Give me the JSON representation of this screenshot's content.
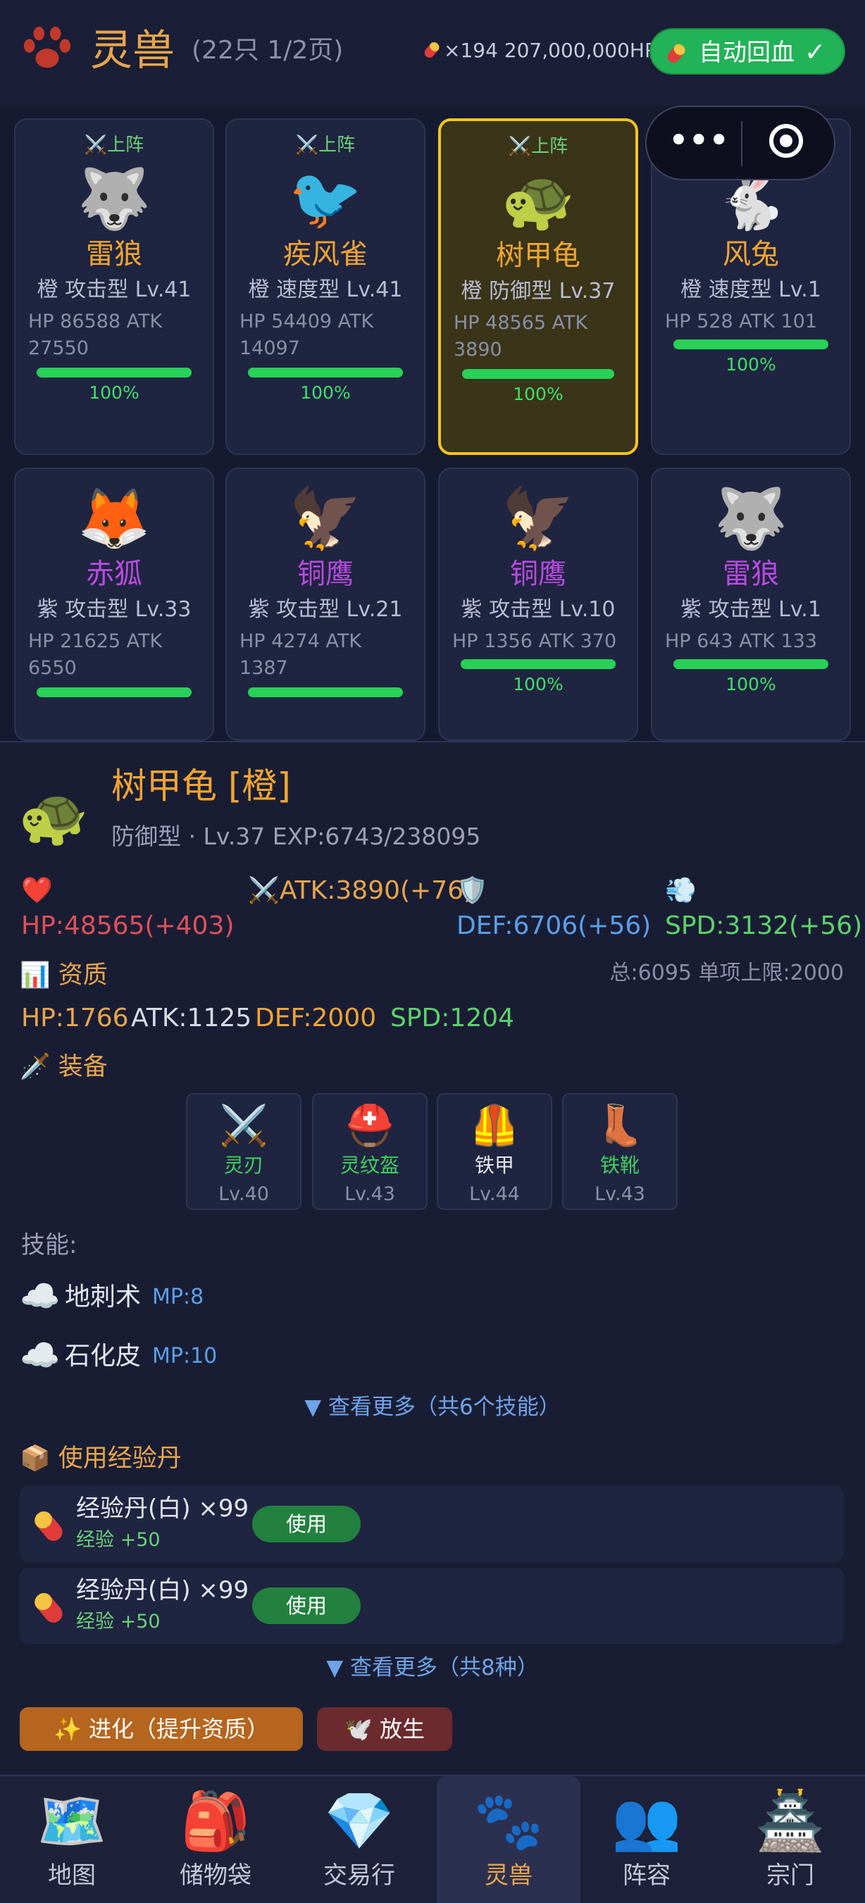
{
  "header": {
    "title": "灵兽",
    "subtitle": "(22只 1/2页)",
    "stock_text": "×194 207,000,000HP",
    "auto_heal_label": "自动回血",
    "auto_heal_check": "✓",
    "paw_icon": "paw-icon",
    "pill_icon": "pill-icon"
  },
  "pets": [
    {
      "tag": "⚔️上阵",
      "emoji": "🐺",
      "name": "雷狼",
      "meta": "橙 攻击型 Lv.41",
      "stats": "HP 86588  ATK 27550",
      "hp_pct_text": "100%",
      "hp_fraction": 1.0,
      "name_color": "#f0a531",
      "selected": false
    },
    {
      "tag": "⚔️上阵",
      "emoji": "🐦",
      "name": "疾风雀",
      "meta": "橙 速度型 Lv.41",
      "stats": "HP 54409  ATK 14097",
      "hp_pct_text": "100%",
      "hp_fraction": 1.0,
      "name_color": "#f0a531",
      "selected": false
    },
    {
      "tag": "⚔️上阵",
      "emoji": "🐢",
      "name": "树甲龟",
      "meta": "橙 防御型 Lv.37",
      "stats": "HP 48565  ATK 3890",
      "hp_pct_text": "100%",
      "hp_fraction": 1.0,
      "name_color": "#f0a531",
      "selected": true
    },
    {
      "tag": "",
      "emoji": "🐇",
      "name": "风兔",
      "meta": "橙 速度型 Lv.1",
      "stats": "HP 528  ATK 101",
      "hp_pct_text": "100%",
      "hp_fraction": 1.0,
      "name_color": "#f0a531",
      "selected": false
    },
    {
      "tag": "",
      "emoji": "🦊",
      "name": "赤狐",
      "meta": "紫 攻击型 Lv.33",
      "stats": "HP 21625  ATK 6550",
      "hp_pct_text": "",
      "hp_fraction": 1.0,
      "name_color": "#b84be0",
      "selected": false
    },
    {
      "tag": "",
      "emoji": "🦅",
      "name": "铜鹰",
      "meta": "紫 攻击型 Lv.21",
      "stats": "HP 4274  ATK 1387",
      "hp_pct_text": "",
      "hp_fraction": 1.0,
      "name_color": "#b84be0",
      "selected": false
    },
    {
      "tag": "",
      "emoji": "🦅",
      "name": "铜鹰",
      "meta": "紫 攻击型 Lv.10",
      "stats": "HP 1356  ATK 370",
      "hp_pct_text": "100%",
      "hp_fraction": 1.0,
      "name_color": "#b84be0",
      "selected": false
    },
    {
      "tag": "",
      "emoji": "🐺",
      "name": "雷狼",
      "meta": "紫 攻击型 Lv.1",
      "stats": "HP 643  ATK 133",
      "hp_pct_text": "100%",
      "hp_fraction": 1.0,
      "name_color": "#b84be0",
      "selected": false
    }
  ],
  "detail": {
    "emoji": "🐢",
    "name": "树甲龟 [橙]",
    "subtitle": "防御型 · Lv.37 EXP:6743/238095",
    "hp": "❤️HP:48565(+403)",
    "atk": "⚔️ATK:3890(+76)",
    "def": "🛡️DEF:6706(+56)",
    "spd": "💨SPD:3132(+56)",
    "aptitude_title": "📊 资质",
    "aptitude_total": "总:6095 单项上限:2000",
    "apt_hp": "HP:1766",
    "apt_atk": "ATK:1125",
    "apt_def": "DEF:2000",
    "apt_spd": "SPD:1204",
    "equip_title": "🗡️ 装备",
    "equipment": [
      {
        "icon": "⚔️",
        "name": "灵刃",
        "level": "Lv.40",
        "color": "#3ecf5e"
      },
      {
        "icon": "⛑️",
        "name": "灵纹盔",
        "level": "Lv.43",
        "color": "#3ecf5e"
      },
      {
        "icon": "🦺",
        "name": "铁甲",
        "level": "Lv.44",
        "color": "#e4e7f2"
      },
      {
        "icon": "👢",
        "name": "铁靴",
        "level": "Lv.43",
        "color": "#3ecf5e"
      }
    ],
    "skills_title": "技能:",
    "skills": [
      {
        "icon": "☁️",
        "name": "地刺术",
        "mp": "MP:8"
      },
      {
        "icon": "☁️",
        "name": "石化皮",
        "mp": "MP:10"
      }
    ],
    "more_skills": "▼ 查看更多（共6个技能）",
    "exp_title": "📦 使用经验丹",
    "items": [
      {
        "name": "经验丹(白) ×99",
        "effect": "经验 +50",
        "use": "使用"
      },
      {
        "name": "经验丹(白) ×99",
        "effect": "经验 +50",
        "use": "使用"
      }
    ],
    "more_items": "▼ 查看更多（共8种）",
    "evolve": "✨ 进化（提升资质）",
    "release": "🕊️ 放生"
  },
  "nav": [
    {
      "icon": "🗺️",
      "label": "地图",
      "active": false
    },
    {
      "icon": "🎒",
      "label": "储物袋",
      "active": false
    },
    {
      "icon": "💎",
      "label": "交易行",
      "active": false
    },
    {
      "icon": "🐾",
      "label": "灵兽",
      "active": true
    },
    {
      "icon": "👥",
      "label": "阵容",
      "active": false
    },
    {
      "icon": "🏯",
      "label": "宗门",
      "active": false
    }
  ],
  "colors": {
    "accent_orange": "#e8a64a",
    "quality_orange": "#f0a531",
    "quality_purple": "#b84be0",
    "green": "#22b258",
    "hp_red": "#e0505a",
    "def_blue": "#5aa0e8",
    "spd_green": "#5cd36a"
  }
}
